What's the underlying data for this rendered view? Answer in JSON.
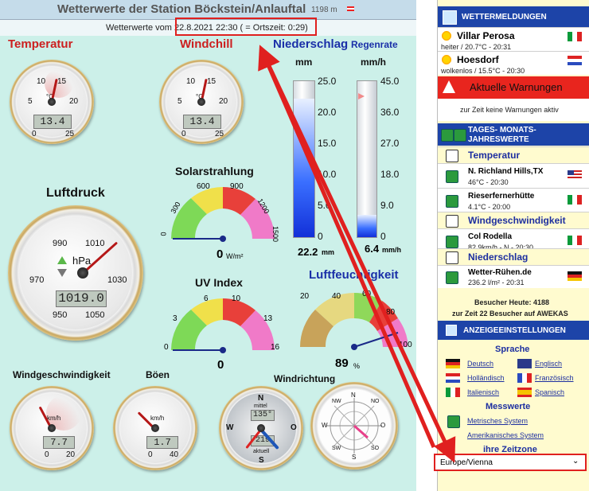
{
  "header": {
    "title": "Wetterwerte der Station Böckstein/Anlauftal",
    "altitude": "1198 m"
  },
  "subheader": {
    "text": "Wetterwerte vom 22.8.2021 22:30 ( = Ortszeit: 0:29)"
  },
  "labels": {
    "temperature": "Temperatur",
    "windchill": "Windchill",
    "precip": "Niederschlag",
    "rainrate": "Regenrate",
    "precip_unit": "mm",
    "rainrate_unit": "mm/h",
    "solar": "Solarstrahlung",
    "pressure": "Luftdruck",
    "uv": "UV Index",
    "humidity": "Luftfeuchtigkeit",
    "windspeed": "Windgeschwindigkeit",
    "gusts": "Böen",
    "winddir": "Windrichtung"
  },
  "temperature": {
    "value": "13.4",
    "unit": "°C",
    "ticks": [
      "5",
      "10",
      "15",
      "20",
      "0",
      "25"
    ]
  },
  "windchill": {
    "value": "13.4",
    "unit": "°C",
    "ticks": [
      "5",
      "10",
      "15",
      "20",
      "0",
      "25"
    ]
  },
  "precip": {
    "value": "22.2",
    "unit": "mm",
    "ticks": [
      "25.0",
      "20.0",
      "15.0",
      "10.0",
      "5.0",
      "0"
    ],
    "fill": 0.888
  },
  "rainrate": {
    "value": "6.4",
    "unit": "mm/h",
    "ticks": [
      "45.0",
      "36.0",
      "27.0",
      "18.0",
      "9.0",
      "0"
    ],
    "fill": 0.142
  },
  "solar": {
    "value": "0",
    "unit": "W/m²",
    "ticks": [
      "0",
      "300",
      "600",
      "900",
      "1200",
      "1500"
    ]
  },
  "pressure": {
    "value": "1019.0",
    "unit": "hPa",
    "ticks": [
      "990",
      "1010",
      "970",
      "1030",
      "950",
      "1050"
    ]
  },
  "uv": {
    "value": "0",
    "ticks": [
      "0",
      "3",
      "6",
      "10",
      "13",
      "16"
    ]
  },
  "humidity": {
    "value": "89",
    "unit": "%",
    "ticks": [
      "20",
      "40",
      "60",
      "80",
      "100",
      "0"
    ]
  },
  "windspeed": {
    "value": "7.7",
    "unit": "km/h",
    "ticks": [
      "0",
      "20"
    ]
  },
  "gusts": {
    "value": "1.7",
    "unit": "km/h",
    "ticks": [
      "0",
      "40"
    ]
  },
  "winddir": {
    "mittel_label": "mittel",
    "mittel": "135°",
    "aktuell": "219",
    "aktuell_label": "aktuell",
    "dirs": [
      "N",
      "O",
      "S",
      "W",
      "NW",
      "NO",
      "SW",
      "SO"
    ]
  },
  "sidebar": {
    "wettermeldungen": "Wettermeldungen",
    "reports": [
      {
        "place": "Villar Perosa",
        "detail": "heiter / 20.7°C - 20:31"
      },
      {
        "place": "Hoesdorf",
        "detail": "wolkenlos / 15.5°C - 20:30"
      }
    ],
    "warnings_title": "Aktuelle Warnungen",
    "warnings_text": "zur Zeit keine Warnungen aktiv",
    "tages_title": "Tages- Monats- Jahreswerte",
    "temp_section": "Temperatur",
    "temp_entries": [
      {
        "place": "N. Richland Hills,TX",
        "detail": "46°C - 20:30"
      },
      {
        "place": "Rieserfernerhütte",
        "detail": "4.1°C - 20:00"
      }
    ],
    "wind_section": "Windgeschwindigkeit",
    "wind_entry": {
      "place": "Col Rodella",
      "detail": "82.9km/h - N - 20:30"
    },
    "precip_section": "Niederschlag",
    "precip_entry": {
      "place": "Wetter-Rühen.de",
      "detail": "236.2 l/m² - 20:31"
    },
    "visitors_today": "Besucher Heute: 4188",
    "visitors_now": "zur Zeit 22 Besucher auf AWEKAS",
    "display_title": "Anzeigeeinstellungen",
    "language_title": "Sprache",
    "languages": [
      "Deutsch",
      "Englisch",
      "Holländisch",
      "Französisch",
      "Italienisch",
      "Spanisch"
    ],
    "messwerte_title": "Messwerte",
    "metric": "Metrisches System",
    "american": "Amerikanisches System",
    "timezone_title": "ihre Zeitzone",
    "timezone": "Europe/Vienna"
  },
  "colors": {
    "annotation": "#e0201f",
    "section": "#1d44a8",
    "warning": "#e8251e",
    "background": "#ccf0e9"
  }
}
